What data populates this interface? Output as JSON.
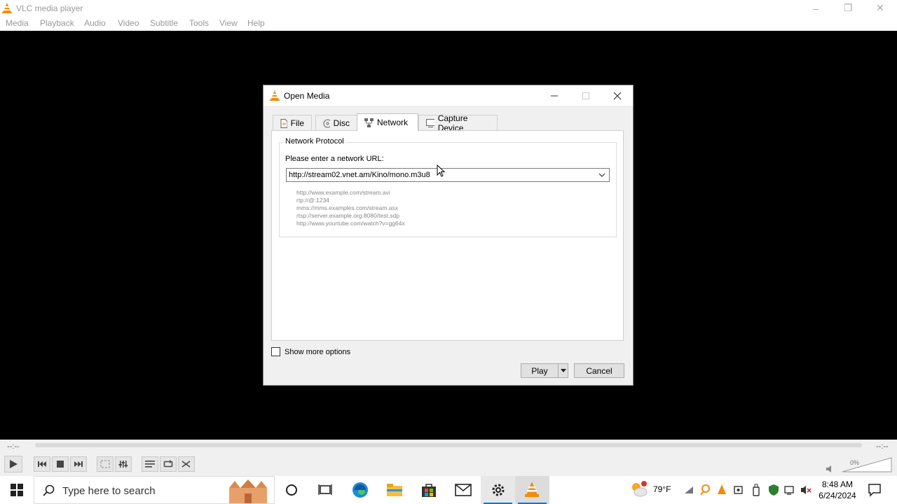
{
  "app": {
    "title": "VLC media player",
    "menu": [
      "Media",
      "Playback",
      "Audio",
      "Video",
      "Subtitle",
      "Tools",
      "View",
      "Help"
    ],
    "window_controls": {
      "minimize": "–",
      "restore": "❐",
      "close": "✕"
    }
  },
  "player": {
    "elapsed": "--:--",
    "remaining": "--:--",
    "volume": "0%"
  },
  "dialog": {
    "title": "Open Media",
    "tabs": [
      {
        "label": "File",
        "icon": "file-icon"
      },
      {
        "label": "Disc",
        "icon": "disc-icon"
      },
      {
        "label": "Network",
        "icon": "network-icon",
        "active": true
      },
      {
        "label": "Capture Device",
        "icon": "capture-device-icon"
      }
    ],
    "group_title": "Network Protocol",
    "url_label": "Please enter a network URL:",
    "url_value": "http://stream02.vnet.am/Kino/mono.m3u8",
    "examples": [
      "http://www.example.com/stream.avi",
      "rtp://@:1234",
      "mms://mms.examples.com/stream.asx",
      "rtsp://server.example.org:8080/test.sdp",
      "http://www.yourtube.com/watch?v=gg64x"
    ],
    "show_more_options": "Show more options",
    "show_more_checked": false,
    "play_label": "Play",
    "cancel_label": "Cancel"
  },
  "taskbar": {
    "search_placeholder": "Type here to search",
    "weather": "79°F",
    "time": "8:48 AM",
    "date": "6/24/2024"
  },
  "colors": {
    "vlc_orange": "#f28c0f",
    "selection_blue": "#0078d7"
  }
}
